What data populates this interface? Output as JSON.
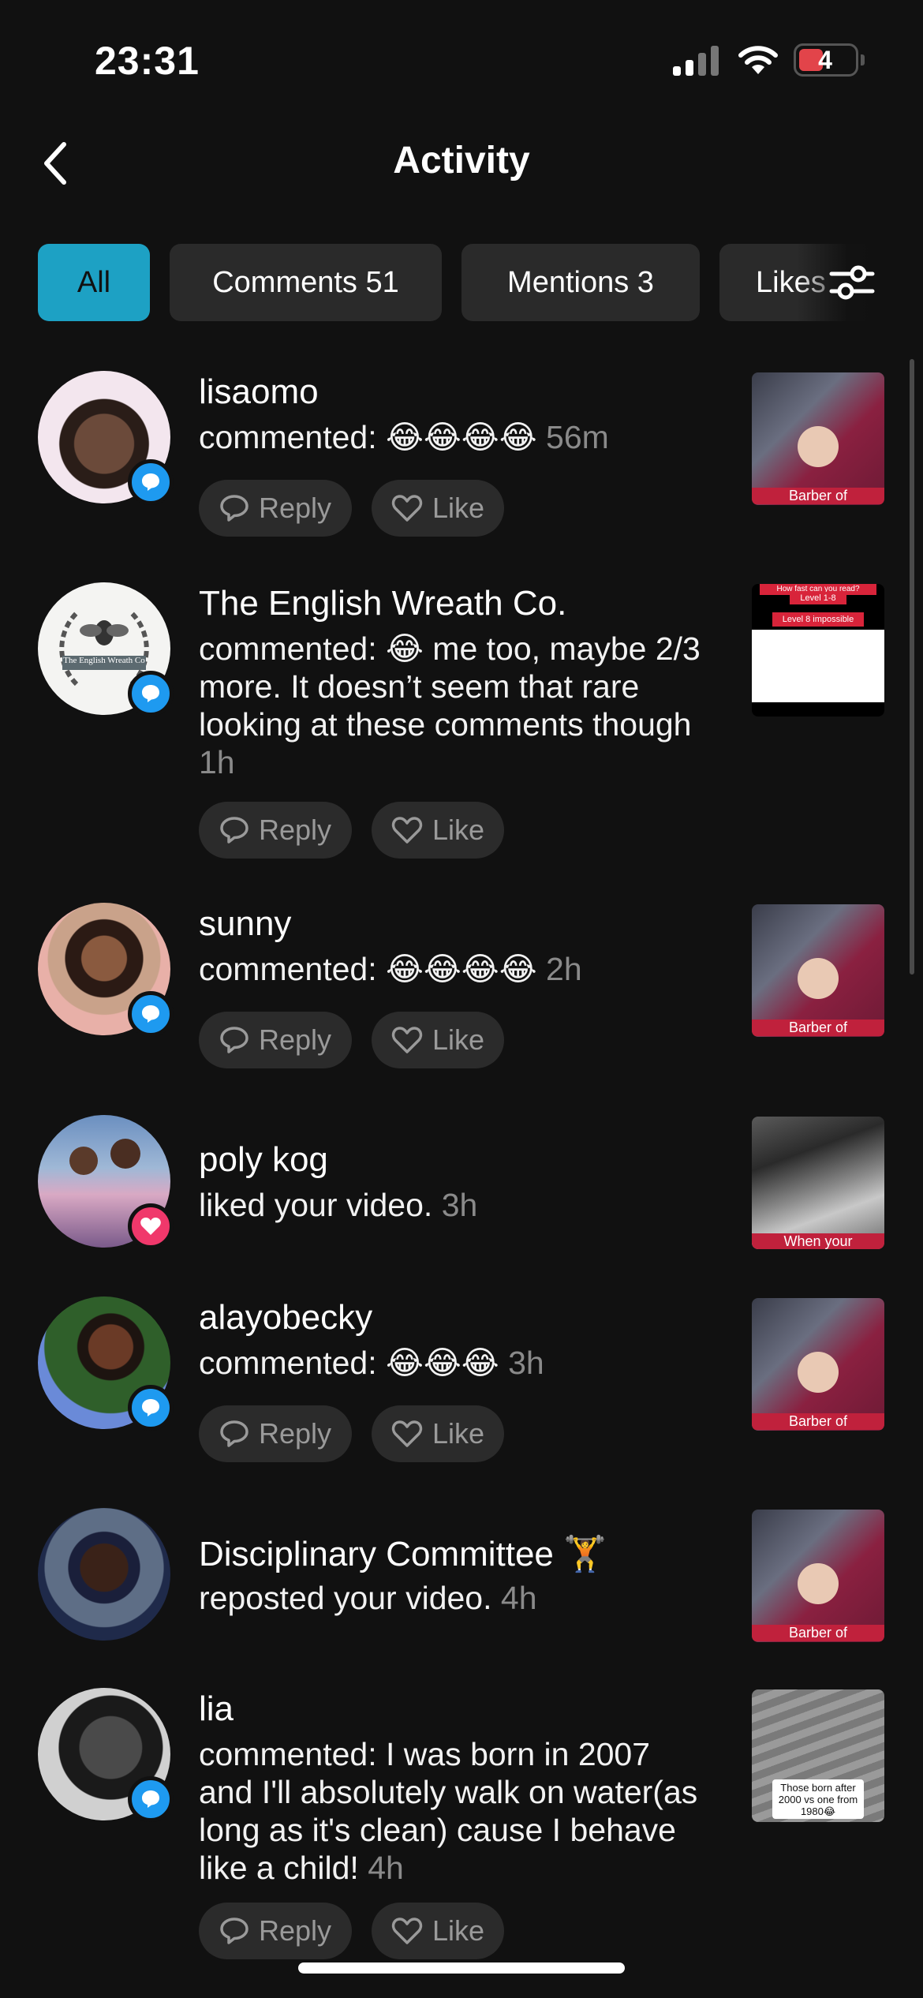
{
  "status_bar": {
    "time": "23:31",
    "battery": "4"
  },
  "header": {
    "title": "Activity"
  },
  "tabs": [
    {
      "label": "All",
      "active": true
    },
    {
      "label": "Comments 51",
      "active": false
    },
    {
      "label": "Mentions 3",
      "active": false
    },
    {
      "label": "Likes",
      "active": false
    }
  ],
  "actions": {
    "reply": "Reply",
    "like": "Like"
  },
  "items": [
    {
      "name": "lisaomo",
      "text": "commented: 😂😂😂😂",
      "time": "56m",
      "type": "comment",
      "thumb_caption": "Barber of"
    },
    {
      "name": "The English Wreath Co.",
      "text": "commented: 😂 me too, maybe 2/3 more. It doesn’t seem that rare looking at these comments though",
      "time": "1h",
      "type": "comment",
      "thumb_caption_1": "How fast can you read?",
      "thumb_caption_2": "Level 1-8",
      "thumb_caption_3": "Level 8 impossible",
      "avatar_text": "The English Wreath Co"
    },
    {
      "name": "sunny",
      "text": "commented: 😂😂😂😂",
      "time": "2h",
      "type": "comment",
      "thumb_caption": "Barber of"
    },
    {
      "name": "poly kog",
      "text": "liked your video.",
      "time": "3h",
      "type": "like",
      "thumb_caption": "When your"
    },
    {
      "name": "alayobecky",
      "text": "commented: 😂😂😂",
      "time": "3h",
      "type": "comment",
      "thumb_caption": "Barber of"
    },
    {
      "name": "Disciplinary Committee 🏋️",
      "text": "reposted your video.",
      "time": "4h",
      "type": "repost",
      "thumb_caption": "Barber of"
    },
    {
      "name": "lia",
      "text": "commented: I was born in 2007 and I'll absolutely walk on water(as long as it's clean) cause I behave like a child!",
      "time": "4h",
      "type": "comment",
      "thumb_caption": "Those born after 2000 vs one from 1980😂"
    }
  ]
}
